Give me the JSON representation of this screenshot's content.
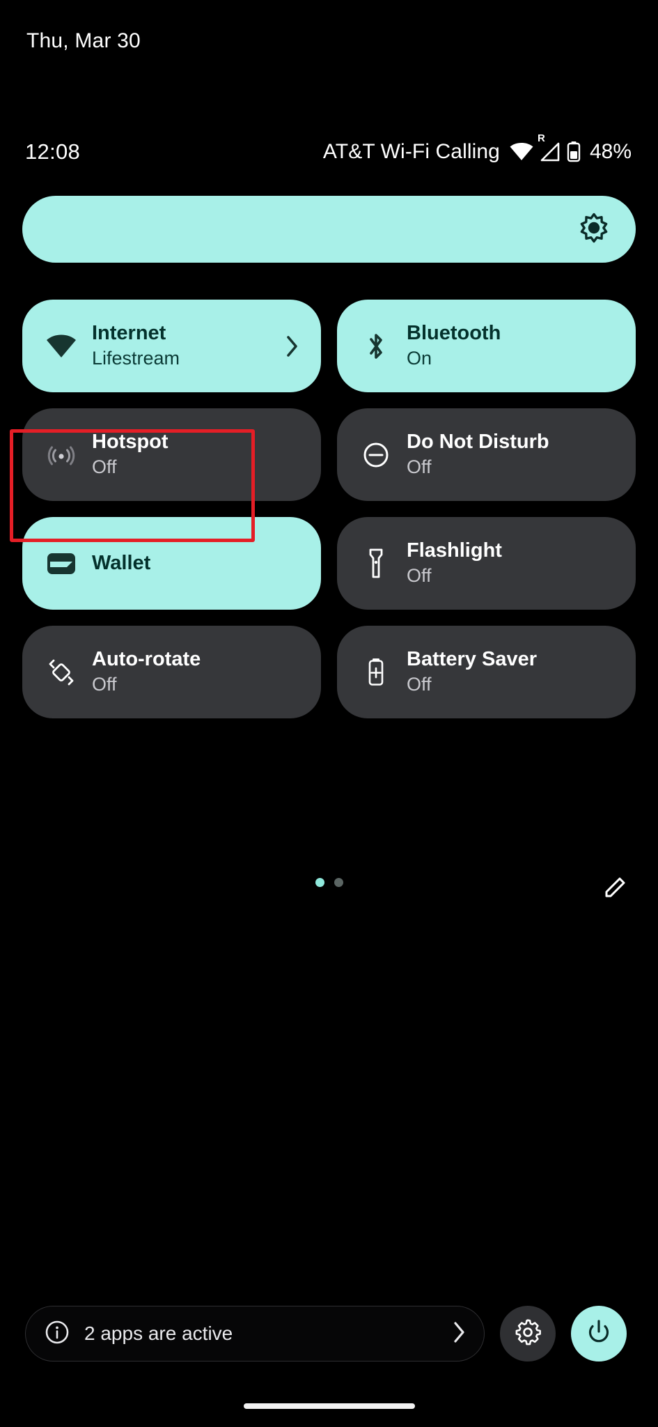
{
  "lockscreen": {
    "date": "Thu, Mar 30"
  },
  "status_bar": {
    "clock": "12:08",
    "carrier": "AT&T Wi-Fi Calling",
    "roaming_indicator": "R",
    "battery_percent": "48%",
    "icons": [
      "wifi-icon",
      "cellular-signal-roaming-icon",
      "battery-icon"
    ]
  },
  "brightness": {
    "icon": "brightness-icon",
    "level_percent": 100,
    "accent_color": "#a8f0e8"
  },
  "tiles": [
    {
      "id": "internet",
      "title": "Internet",
      "subtitle": "Lifestream",
      "state": "on",
      "icon": "wifi-icon",
      "has_chevron": true
    },
    {
      "id": "bluetooth",
      "title": "Bluetooth",
      "subtitle": "On",
      "state": "on",
      "icon": "bluetooth-icon",
      "has_chevron": false
    },
    {
      "id": "hotspot",
      "title": "Hotspot",
      "subtitle": "Off",
      "state": "off",
      "icon": "hotspot-icon",
      "has_chevron": false,
      "highlighted": true
    },
    {
      "id": "do-not-disturb",
      "title": "Do Not Disturb",
      "subtitle": "Off",
      "state": "off",
      "icon": "do-not-disturb-icon",
      "has_chevron": false
    },
    {
      "id": "wallet",
      "title": "Wallet",
      "subtitle": "",
      "state": "on",
      "icon": "wallet-icon",
      "has_chevron": false
    },
    {
      "id": "flashlight",
      "title": "Flashlight",
      "subtitle": "Off",
      "state": "off",
      "icon": "flashlight-icon",
      "has_chevron": false
    },
    {
      "id": "auto-rotate",
      "title": "Auto-rotate",
      "subtitle": "Off",
      "state": "off",
      "icon": "auto-rotate-icon",
      "has_chevron": false
    },
    {
      "id": "battery-saver",
      "title": "Battery Saver",
      "subtitle": "Off",
      "state": "off",
      "icon": "battery-saver-icon",
      "has_chevron": false
    }
  ],
  "pager": {
    "page_count": 2,
    "active_page": 1,
    "edit_icon": "pencil-icon"
  },
  "footer": {
    "apps_active_label": "2 apps are active",
    "apps_active_icon": "info-icon",
    "apps_active_chevron": "chevron-right-icon",
    "settings_icon": "gear-icon",
    "power_icon": "power-icon"
  },
  "theme": {
    "background": "#000000",
    "accent": "#a8f0e8",
    "tile_off": "#36373a",
    "highlight_box": "#e41e26"
  }
}
